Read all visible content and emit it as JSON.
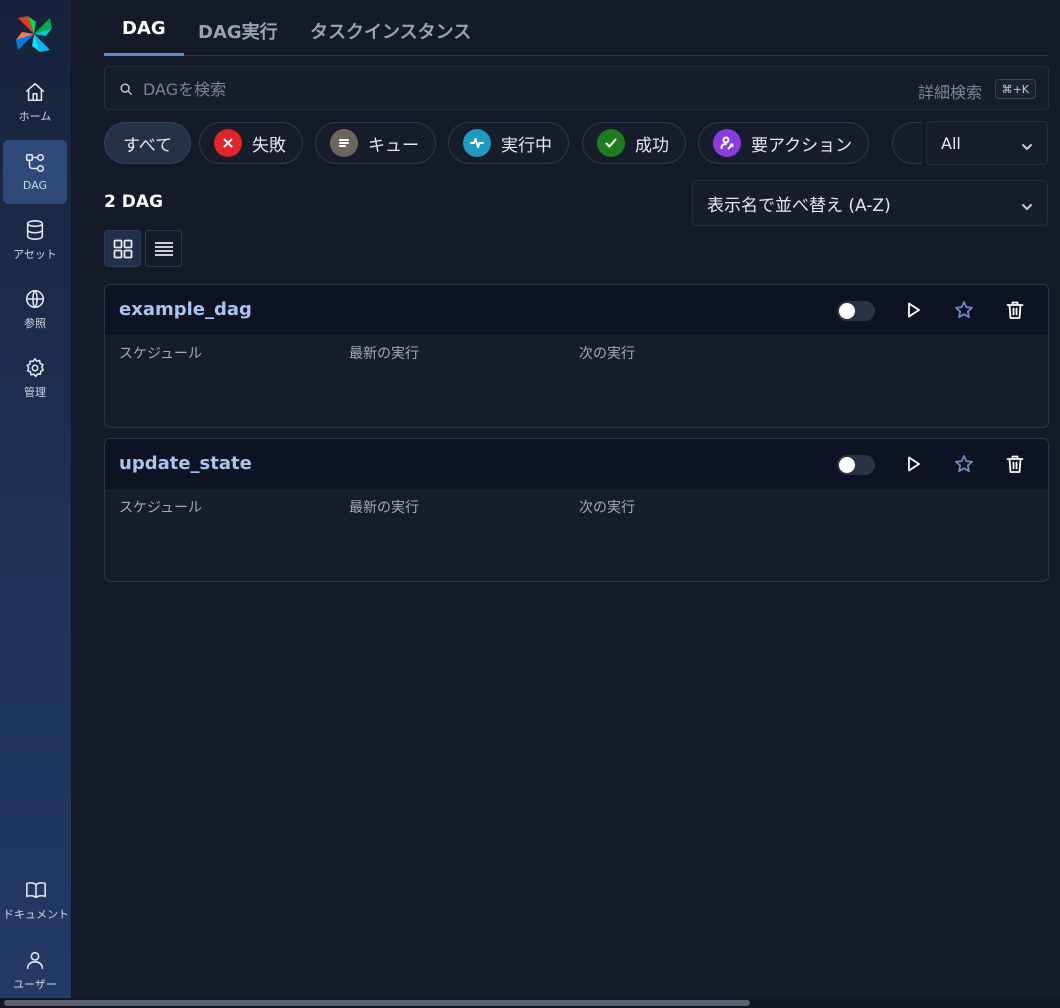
{
  "sidebar": {
    "items": [
      {
        "label": "ホーム",
        "icon": "home-icon"
      },
      {
        "label": "DAG",
        "icon": "dag-icon",
        "active": true
      },
      {
        "label": "アセット",
        "icon": "database-icon"
      },
      {
        "label": "参照",
        "icon": "globe-icon"
      },
      {
        "label": "管理",
        "icon": "gear-icon"
      }
    ],
    "bottom": [
      {
        "label": "ドキュメント",
        "icon": "book-icon"
      },
      {
        "label": "ユーザー",
        "icon": "user-icon"
      }
    ]
  },
  "tabs": [
    {
      "label": "DAG",
      "active": true
    },
    {
      "label": "DAG実行"
    },
    {
      "label": "タスクインスタンス"
    }
  ],
  "search": {
    "placeholder": "DAGを検索",
    "advanced_label": "詳細検索",
    "shortcut": "⌘+K"
  },
  "filters": [
    {
      "label": "すべて",
      "selected": true
    },
    {
      "label": "失敗",
      "icon": "x-icon",
      "color": "#e0252c"
    },
    {
      "label": "キュー",
      "icon": "queue-icon",
      "color": "#6b6660"
    },
    {
      "label": "実行中",
      "icon": "pulse-icon",
      "color": "#1f9bbf"
    },
    {
      "label": "成功",
      "icon": "check-icon",
      "color": "#1e7d1e"
    },
    {
      "label": "要アクション",
      "icon": "user-action-icon",
      "color": "#8a3ce0"
    }
  ],
  "tag_select": {
    "value": "All"
  },
  "dag_count": "2 DAG",
  "sort": {
    "value": "表示名で並べ替え (A-Z)"
  },
  "card_labels": {
    "schedule": "スケジュール",
    "latest_run": "最新の実行",
    "next_run": "次の実行"
  },
  "dags": [
    {
      "name": "example_dag",
      "paused": true
    },
    {
      "name": "update_state",
      "paused": true
    }
  ]
}
